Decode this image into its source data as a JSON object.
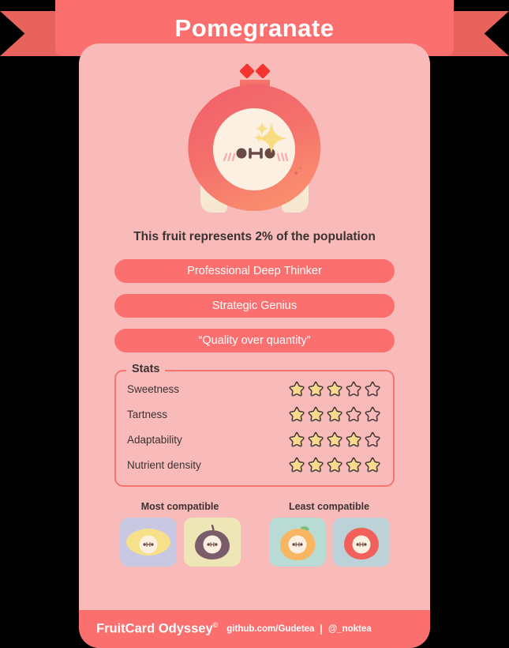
{
  "header": {
    "title": "Pomegranate",
    "ribbon_color": "#FB6F6F",
    "ribbon_tail_color": "#E8635C"
  },
  "card": {
    "background_color": "#F9BABA",
    "population_line": "This fruit represents 2% of the population",
    "character": {
      "name": "pomegranate-character",
      "body_color": "#F8E9D8",
      "shell_color": "#F26A6A",
      "crown_color": "#F14B4B",
      "sparkle_color": "#F9DC82"
    }
  },
  "tags": [
    {
      "label": "Professional Deep Thinker"
    },
    {
      "label": "Strategic Genius"
    },
    {
      "label": "“Quality over quantity”"
    }
  ],
  "stats": {
    "legend": "Stats",
    "max": 5,
    "star_filled_color": "#F8DA8E",
    "star_outline_color": "#4A3A3A",
    "rows": [
      {
        "label": "Sweetness",
        "value": 3
      },
      {
        "label": "Tartness",
        "value": 3
      },
      {
        "label": "Adaptability",
        "value": 4
      },
      {
        "label": "Nutrient density",
        "value": 5
      }
    ]
  },
  "compatibility": {
    "most": {
      "heading": "Most compatible",
      "items": [
        {
          "name": "lemon",
          "bg": "#C9C8E3",
          "fruit": "#F7E08A"
        },
        {
          "name": "fig",
          "bg": "#EFE6B8",
          "fruit": "#7B5C6B"
        }
      ]
    },
    "least": {
      "heading": "Least compatible",
      "items": [
        {
          "name": "mango",
          "bg": "#B8DBD3",
          "fruit": "#F8B662"
        },
        {
          "name": "tomato",
          "bg": "#BCD2D8",
          "fruit": "#F2605C"
        }
      ]
    }
  },
  "footer": {
    "brand": "FruitCard Odyssey",
    "brand_mark": "©",
    "repo": "github.com/Gudetea",
    "handle": "@_noktea"
  }
}
